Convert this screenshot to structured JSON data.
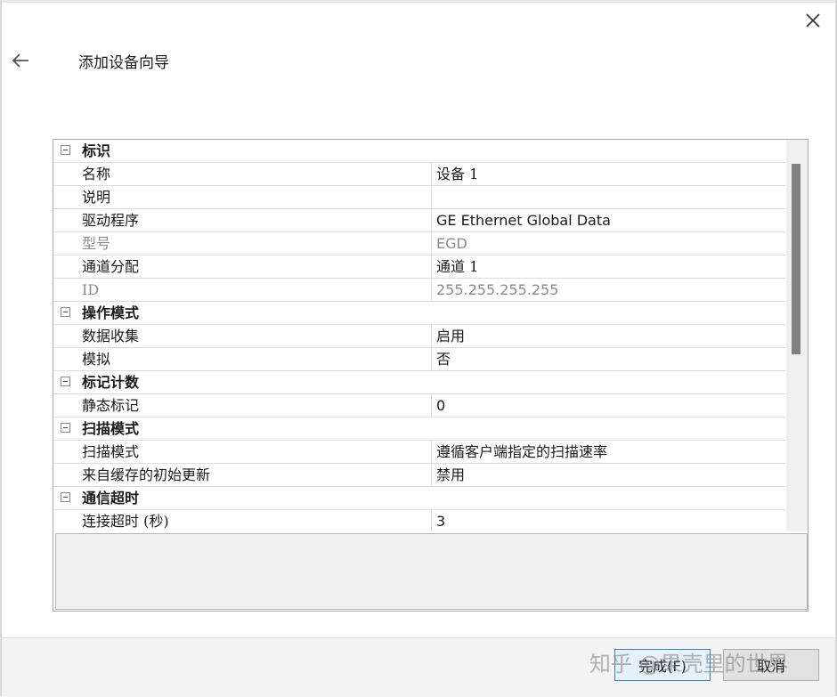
{
  "window": {
    "title": "添加设备向导"
  },
  "icons": {
    "back": "arrow-left-icon",
    "close": "close-x-icon",
    "collapse": "minus-box-icon"
  },
  "grid": {
    "rows": [
      {
        "kind": "category",
        "label": "标识"
      },
      {
        "kind": "property",
        "name": "名称",
        "value": "设备 1",
        "disabled": false
      },
      {
        "kind": "property",
        "name": "说明",
        "value": "",
        "disabled": false
      },
      {
        "kind": "property",
        "name": "驱动程序",
        "value": "GE Ethernet Global Data",
        "disabled": false
      },
      {
        "kind": "property",
        "name": "型号",
        "value": "EGD",
        "disabled": true
      },
      {
        "kind": "property",
        "name": "通道分配",
        "value": "通道 1",
        "disabled": false
      },
      {
        "kind": "property",
        "name": "ID",
        "value": "255.255.255.255",
        "disabled": true
      },
      {
        "kind": "category",
        "label": "操作模式"
      },
      {
        "kind": "property",
        "name": "数据收集",
        "value": "启用",
        "disabled": false
      },
      {
        "kind": "property",
        "name": "模拟",
        "value": "否",
        "disabled": false
      },
      {
        "kind": "category",
        "label": "标记计数"
      },
      {
        "kind": "property",
        "name": "静态标记",
        "value": "0",
        "disabled": false
      },
      {
        "kind": "category",
        "label": "扫描模式"
      },
      {
        "kind": "property",
        "name": "扫描模式",
        "value": "遵循客户端指定的扫描速率",
        "disabled": false
      },
      {
        "kind": "property",
        "name": "来自缓存的初始更新",
        "value": "禁用",
        "disabled": false
      },
      {
        "kind": "category",
        "label": "通信超时"
      },
      {
        "kind": "property",
        "name": "连接超时 (秒)",
        "value": "3",
        "disabled": false
      }
    ]
  },
  "footer": {
    "finish_label": "完成(F)",
    "cancel_label": "取消"
  },
  "watermark": "知乎 @果壳里的世界"
}
